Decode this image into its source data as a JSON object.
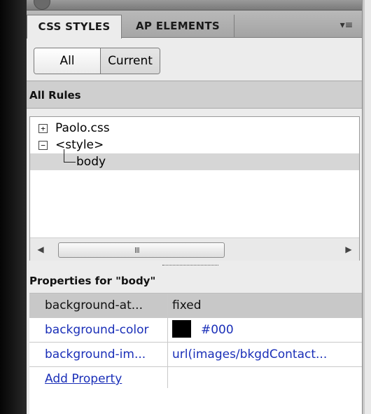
{
  "tabs": {
    "css_styles": "CSS STYLES",
    "ap_elements": "AP ELEMENTS",
    "menu_glyph": "▾≡"
  },
  "mode_toggle": {
    "all": "All",
    "current": "Current",
    "selected": "All"
  },
  "all_rules": {
    "header": "All Rules",
    "tree": [
      {
        "label": "Paolo.css",
        "expander": "+",
        "level": 0
      },
      {
        "label": "<style>",
        "expander": "−",
        "level": 0
      },
      {
        "label": "body",
        "expander": "",
        "level": 1,
        "selected": true
      }
    ],
    "scrollbar": {
      "left_arrow": "◀",
      "right_arrow": "▶",
      "grip": "III"
    }
  },
  "properties": {
    "header": "Properties for \"body\"",
    "rows": [
      {
        "name": "background-at...",
        "value": "fixed",
        "selected": true
      },
      {
        "name": "background-color",
        "value": "#000",
        "swatch": "#000000"
      },
      {
        "name": "background-im...",
        "value": "url(images/bkgdContact..."
      }
    ],
    "add_property": "Add Property"
  },
  "colors": {
    "link_blue": "#1a2fb8",
    "selection_gray": "#c8c8c8",
    "panel_bg": "#ececec"
  }
}
